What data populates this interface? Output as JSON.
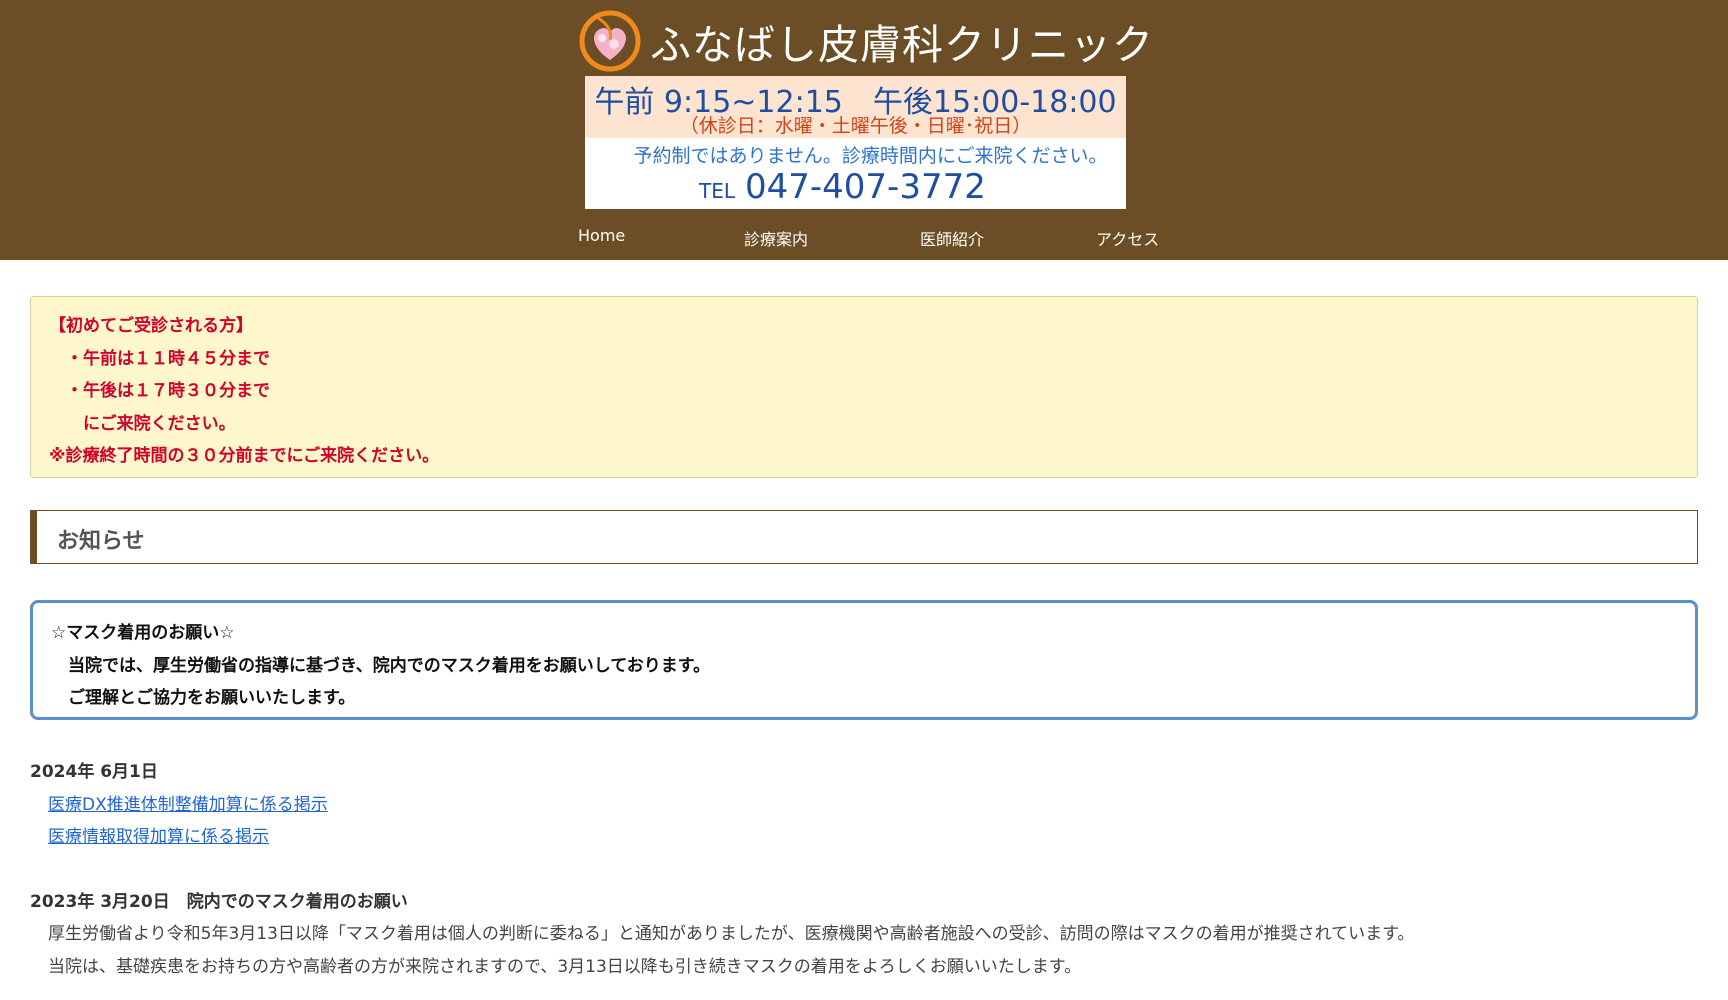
{
  "header": {
    "title": "ふなばし皮膚科クリニック",
    "logo_icon": "heart-flower-logo",
    "colors": {
      "header_bg": "#6b4e25",
      "logo_orange": "#f08a1c",
      "logo_pink": "#f4b2c8"
    },
    "hours": {
      "main": "午前 9:15~12:15　午後15:00-18:00",
      "holiday": "（休診日：水曜・土曜午後・日曜･祝日）",
      "note": "予約制ではありません。診療時間内にご来院ください。",
      "tel_label": "TEL",
      "tel_number": "047-407-3772"
    }
  },
  "nav": {
    "items": [
      {
        "label": "Home"
      },
      {
        "label": "診療案内"
      },
      {
        "label": "医師紹介"
      },
      {
        "label": "アクセス"
      }
    ]
  },
  "notice": {
    "lines": [
      "【初めてご受診される方】",
      "　・午前は１１時４５分まで",
      "　・午後は１７時３０分まで",
      "　　にご来院ください。",
      "※診療終了時間の３０分前までにご来院ください。"
    ]
  },
  "section": {
    "title": "お知らせ"
  },
  "mask_box": {
    "lines": [
      "☆マスク着用のお願い☆",
      "　当院では、厚生労働省の指導に基づき、院内でのマスク着用をお願いしております。",
      "　ご理解とご協力をお願いいたします。"
    ]
  },
  "news": [
    {
      "date": "2024年 6月1日",
      "links": [
        "医療DX推進体制整備加算に係る掲示",
        "医療情報取得加算に係る掲示"
      ]
    },
    {
      "date": "2023年 3月20日　院内でのマスク着用のお願い",
      "body": [
        "厚生労働省より令和5年3月13日以降「マスク着用は個人の判断に委ねる」と通知がありましたが、医療機関や高齢者施設への受診、訪問の際はマスクの着用が推奨されています。",
        "当院は、基礎疾患をお持ちの方や高齢者の方が来院されますので、3月13日以降も引き続きマスクの着用をよろしくお願いいたします。"
      ]
    }
  ]
}
